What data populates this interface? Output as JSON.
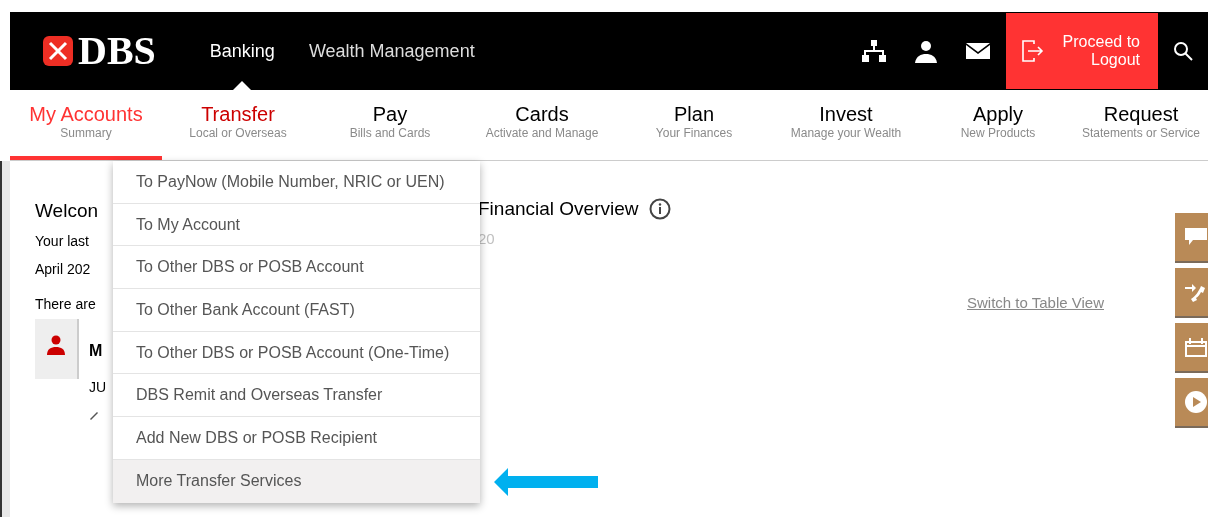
{
  "header": {
    "logo": "DBS",
    "tabs": [
      {
        "label": "Banking",
        "selected": true
      },
      {
        "label": "Wealth Management",
        "selected": false
      }
    ],
    "logout": "Proceed to Logout"
  },
  "nav": [
    {
      "title": "My Accounts",
      "subtitle": "Summary",
      "selected": true,
      "open": false
    },
    {
      "title": "Transfer",
      "subtitle": "Local or Overseas",
      "selected": false,
      "open": true
    },
    {
      "title": "Pay",
      "subtitle": "Bills and Cards",
      "selected": false,
      "open": false
    },
    {
      "title": "Cards",
      "subtitle": "Activate and Manage",
      "selected": false,
      "open": false
    },
    {
      "title": "Plan",
      "subtitle": "Your Finances",
      "selected": false,
      "open": false
    },
    {
      "title": "Invest",
      "subtitle": "Manage your Wealth",
      "selected": false,
      "open": false
    },
    {
      "title": "Apply",
      "subtitle": "New Products",
      "selected": false,
      "open": false
    },
    {
      "title": "Request",
      "subtitle": "Statements or Service",
      "selected": false,
      "open": false
    }
  ],
  "dropdown": [
    {
      "label": "To PayNow (Mobile Number, NRIC or UEN)",
      "selected": false
    },
    {
      "label": "To My Account",
      "selected": false
    },
    {
      "label": "To Other DBS or POSB Account",
      "selected": false
    },
    {
      "label": "To Other Bank Account (FAST)",
      "selected": false
    },
    {
      "label": "To Other DBS or POSB Account (One-Time)",
      "selected": false
    },
    {
      "label": "DBS Remit and Overseas Transfer",
      "selected": false
    },
    {
      "label": "Add New DBS or POSB Recipient",
      "selected": false
    },
    {
      "label": "More Transfer Services",
      "selected": true
    }
  ],
  "welcome": {
    "title": "Welcon",
    "lines": [
      "Your last",
      "April 202"
    ],
    "notice": "There are",
    "contact_name": "M",
    "contact_line": "JU"
  },
  "overview": {
    "title": "Financial Overview",
    "subtitle": "20",
    "link": "Switch to Table View"
  }
}
